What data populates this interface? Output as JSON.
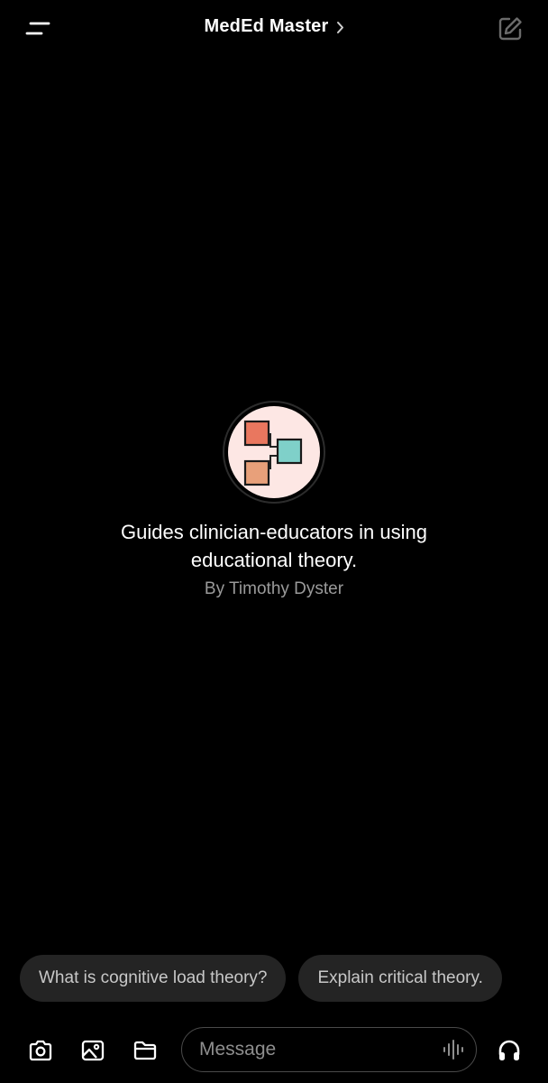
{
  "header": {
    "title": "MedEd Master",
    "icons": {
      "menu": "menu-icon",
      "chevron": "chevron-right-icon",
      "compose": "new-chat-icon"
    }
  },
  "gpt": {
    "description": "Guides clinician-educators in using educational theory.",
    "author": "By Timothy Dyster",
    "avatar_icon": "flowchart-icon",
    "avatar_colors": {
      "background": "#fde7e4",
      "top_box": "#e9775f",
      "right_box": "#7fd0c9",
      "bottom_box": "#e8a07a"
    }
  },
  "suggestions": [
    "What is cognitive load theory?",
    "Explain critical theory."
  ],
  "composer": {
    "placeholder": "Message",
    "icons": {
      "camera": "camera-icon",
      "photos": "photo-icon",
      "files": "folder-icon",
      "voice": "waveform-icon",
      "headphones": "headphones-icon"
    }
  },
  "colors": {
    "background": "#000000",
    "chip_background": "#242424",
    "secondary_text": "#9a9a9a"
  }
}
